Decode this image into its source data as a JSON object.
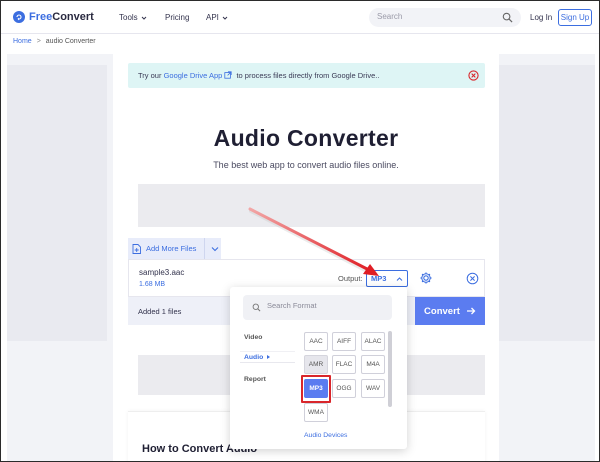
{
  "nav": {
    "logo_free": "Free",
    "logo_convert": "Convert",
    "tools": "Tools",
    "pricing": "Pricing",
    "api": "API",
    "search_placeholder": "Search",
    "login": "Log In",
    "signup": "Sign Up"
  },
  "breadcrumb": {
    "home": "Home",
    "separator": ">",
    "current": "audio Converter"
  },
  "banner": {
    "prefix": "Try our ",
    "link": "Google Drive App",
    "suffix": " to process files directly from Google Drive.."
  },
  "page": {
    "title": "Audio Converter",
    "subtitle": "The best web app to convert audio files online."
  },
  "uploader": {
    "add_more_files": "Add More Files",
    "file_name": "sample3.aac",
    "file_size": "1.68 MB",
    "output_label": "Output:",
    "output_value": "MP3",
    "added_text": "Added 1 files",
    "convert_label": "Convert"
  },
  "format_popup": {
    "search_placeholder": "Search Format",
    "categories": [
      "Video",
      "Audio",
      "Report"
    ],
    "active_category": "Audio",
    "formats": [
      "AAC",
      "AIFF",
      "ALAC",
      "AMR",
      "FLAC",
      "M4A",
      "MP3",
      "OGG",
      "WAV",
      "WMA"
    ],
    "selected_format": "MP3",
    "devices_label": "Audio Devices"
  },
  "howto": {
    "title": "How to Convert Audio"
  },
  "colors": {
    "brand": "#3c6ee0",
    "convert_button": "#5b7cf0",
    "banner_bg": "#def5f5",
    "annotation_red": "#d9262b"
  }
}
